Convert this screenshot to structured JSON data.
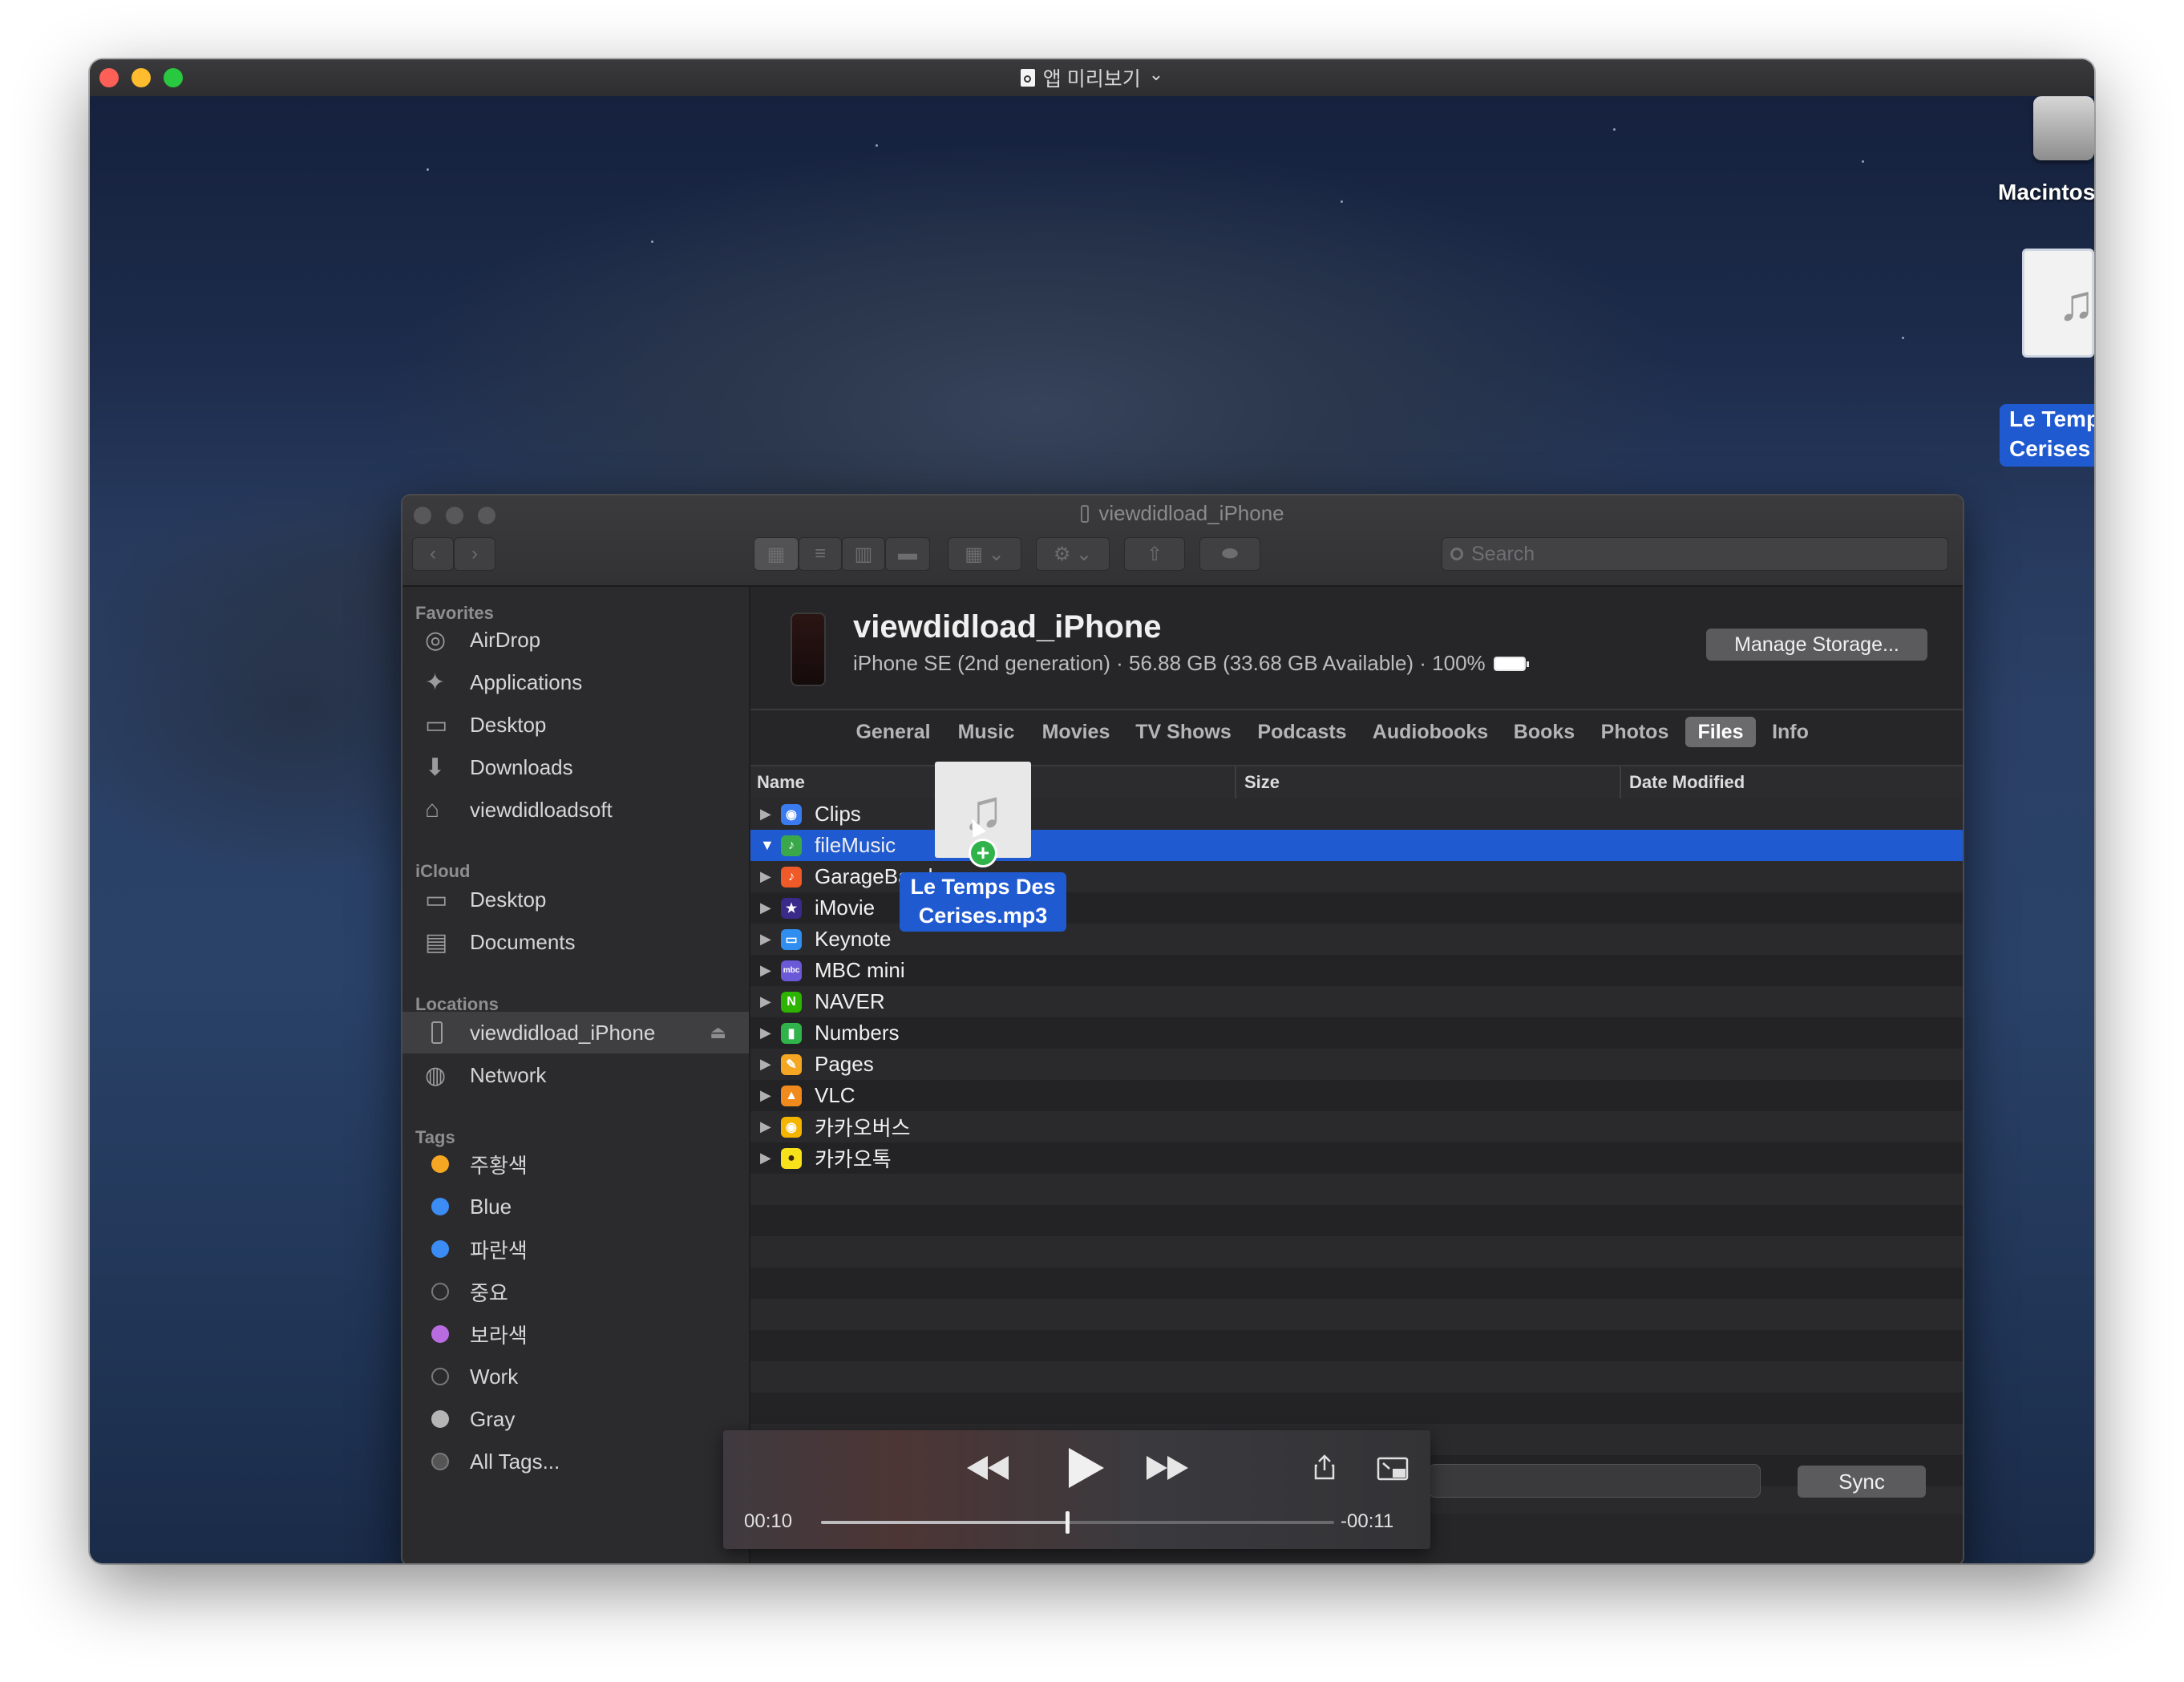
{
  "outer_window": {
    "title": "앱 미리보기",
    "title_chevron": "⌄",
    "traffic_lights": {
      "close": "#fe5f57",
      "minimize": "#febc2e",
      "zoom": "#28c840"
    }
  },
  "desktop": {
    "hd_label": "Macintos",
    "file_label_line1": "Le Temp",
    "file_label_line2": "Cerises"
  },
  "finder": {
    "title": "viewdidload_iPhone",
    "search_placeholder": "Search",
    "sidebar": {
      "favorites_title": "Favorites",
      "favorites": [
        {
          "label": "AirDrop",
          "icon": "airdrop-icon"
        },
        {
          "label": "Applications",
          "icon": "applications-icon"
        },
        {
          "label": "Desktop",
          "icon": "desktop-folder-icon"
        },
        {
          "label": "Downloads",
          "icon": "downloads-icon"
        },
        {
          "label": "viewdidloadsoft",
          "icon": "home-icon"
        }
      ],
      "icloud_title": "iCloud",
      "icloud": [
        {
          "label": "Desktop",
          "icon": "desktop-folder-icon"
        },
        {
          "label": "Documents",
          "icon": "documents-icon"
        }
      ],
      "locations_title": "Locations",
      "locations": [
        {
          "label": "viewdidload_iPhone",
          "icon": "iphone-icon"
        },
        {
          "label": "Network",
          "icon": "network-icon"
        }
      ],
      "tags_title": "Tags",
      "tags": [
        {
          "label": "주황색",
          "color": "#f5a623"
        },
        {
          "label": "Blue",
          "color": "#3b8cf5"
        },
        {
          "label": "파란색",
          "color": "#3b8cf5"
        },
        {
          "label": "중요",
          "color": "none"
        },
        {
          "label": "보라색",
          "color": "#b86ce0"
        },
        {
          "label": "Work",
          "color": "none"
        },
        {
          "label": "Gray",
          "color": "#b5b5b5"
        },
        {
          "label": "All Tags...",
          "color": "all"
        }
      ]
    },
    "device": {
      "name": "viewdidload_iPhone",
      "subtitle": "iPhone SE (2nd generation) · 56.88 GB (33.68 GB Available) · 100%",
      "battery_percent": 100,
      "manage_button": "Manage Storage..."
    },
    "tabs": [
      "General",
      "Music",
      "Movies",
      "TV Shows",
      "Podcasts",
      "Audiobooks",
      "Books",
      "Photos",
      "Files",
      "Info"
    ],
    "active_tab": "Files",
    "columns": {
      "name": "Name",
      "size": "Size",
      "date": "Date Modified"
    },
    "files": [
      {
        "name": "Clips",
        "icon": "clips-app-icon",
        "color": "#3b7bf0",
        "expanded": false
      },
      {
        "name": "fileMusic",
        "icon": "filemusic-app-icon",
        "color": "#3aa84a",
        "expanded": true,
        "selected": true
      },
      {
        "name": "GarageBand",
        "icon": "garageband-app-icon",
        "color": "#f05a28",
        "expanded": false
      },
      {
        "name": "iMovie",
        "icon": "imovie-app-icon",
        "color": "#3a2a8a",
        "expanded": false
      },
      {
        "name": "Keynote",
        "icon": "keynote-app-icon",
        "color": "#2f8ef0",
        "expanded": false
      },
      {
        "name": "MBC mini",
        "icon": "mbc-mini-app-icon",
        "color": "#6a5ad8",
        "expanded": false
      },
      {
        "name": "NAVER",
        "icon": "naver-app-icon",
        "color": "#2db400",
        "expanded": false
      },
      {
        "name": "Numbers",
        "icon": "numbers-app-icon",
        "color": "#2fb34a",
        "expanded": false
      },
      {
        "name": "Pages",
        "icon": "pages-app-icon",
        "color": "#f5a623",
        "expanded": false
      },
      {
        "name": "VLC",
        "icon": "vlc-app-icon",
        "color": "#f08a1c",
        "expanded": false
      },
      {
        "name": "카카오버스",
        "icon": "kakaobus-app-icon",
        "color": "#f5b400",
        "expanded": false
      },
      {
        "name": "카카오톡",
        "icon": "kakaotalk-app-icon",
        "color": "#f7e11a",
        "expanded": false
      }
    ],
    "drag": {
      "label_line1": "Le Temps Des",
      "label_line2": "Cerises.mp3"
    },
    "sync_button": "Sync"
  },
  "player": {
    "elapsed": "00:10",
    "remaining": "-00:11",
    "progress": 0.48
  }
}
